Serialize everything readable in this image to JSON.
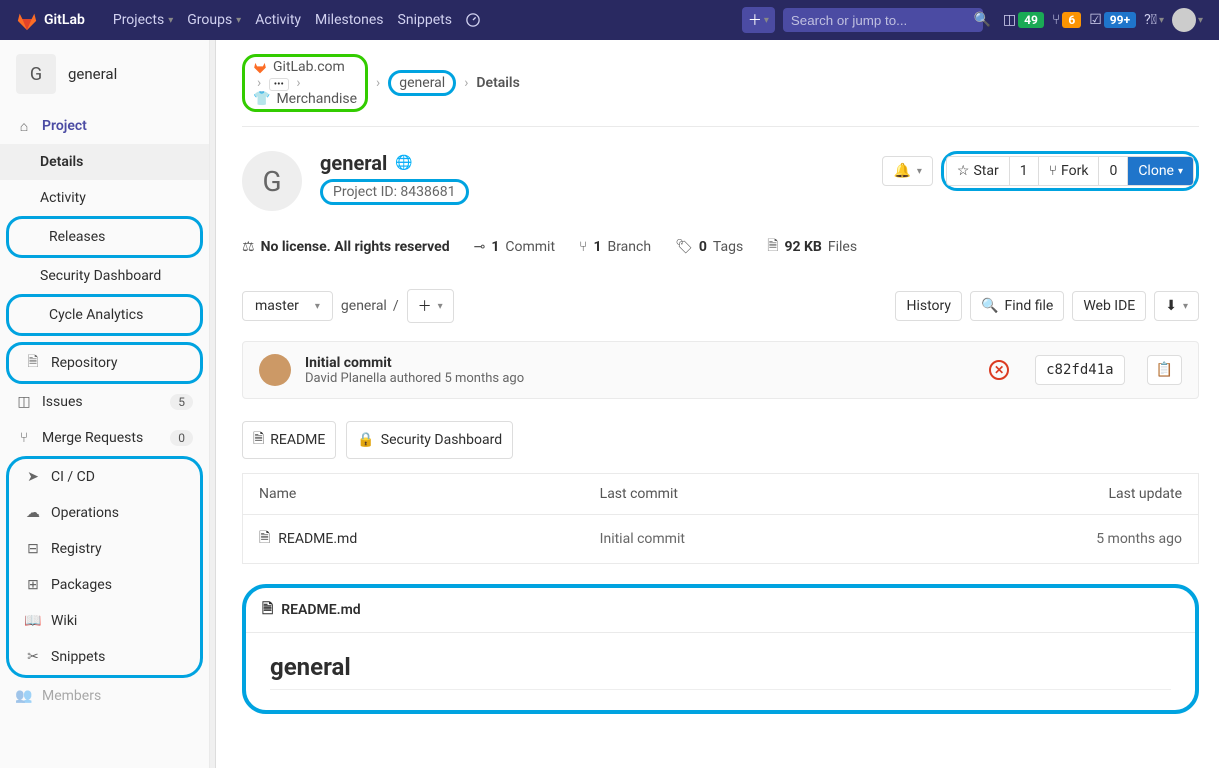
{
  "navbar": {
    "brand": "GitLab",
    "links": [
      "Projects",
      "Groups",
      "Activity",
      "Milestones",
      "Snippets"
    ],
    "search_placeholder": "Search or jump to...",
    "badges": {
      "todos": "49",
      "mrs": "6",
      "issues": "99+"
    }
  },
  "sidebar": {
    "context": {
      "letter": "G",
      "name": "general"
    },
    "project_label": "Project",
    "project_subs": [
      "Details",
      "Activity",
      "Releases",
      "Security Dashboard",
      "Cycle Analytics"
    ],
    "items": [
      {
        "label": "Repository",
        "icon": "doc"
      },
      {
        "label": "Issues",
        "icon": "issues",
        "count": "5"
      },
      {
        "label": "Merge Requests",
        "icon": "mr",
        "count": "0"
      },
      {
        "label": "CI / CD",
        "icon": "rocket"
      },
      {
        "label": "Operations",
        "icon": "cloud"
      },
      {
        "label": "Registry",
        "icon": "disk"
      },
      {
        "label": "Packages",
        "icon": "package"
      },
      {
        "label": "Wiki",
        "icon": "book"
      },
      {
        "label": "Snippets",
        "icon": "scissors"
      },
      {
        "label": "Members",
        "icon": "users"
      }
    ]
  },
  "breadcrumb": {
    "root": "GitLab.com",
    "group": "Merchandise",
    "project": "general",
    "page": "Details"
  },
  "project": {
    "letter": "G",
    "name": "general",
    "id_label": "Project ID: 8438681",
    "star_label": "Star",
    "star_count": "1",
    "fork_label": "Fork",
    "fork_count": "0",
    "clone_label": "Clone"
  },
  "info": {
    "license": "No license. All rights reserved",
    "commits_n": "1",
    "commits_l": "Commit",
    "branches_n": "1",
    "branches_l": "Branch",
    "tags_n": "0",
    "tags_l": "Tags",
    "size_n": "92 KB",
    "size_l": "Files"
  },
  "branch": {
    "ref": "master",
    "path": "general",
    "sep": "/",
    "history": "History",
    "find": "Find file",
    "ide": "Web IDE"
  },
  "commit": {
    "title": "Initial commit",
    "meta": "David Planella authored 5 months ago",
    "sha": "c82fd41a"
  },
  "quicklinks": {
    "readme": "README",
    "security": "Security Dashboard"
  },
  "table": {
    "headers": [
      "Name",
      "Last commit",
      "Last update"
    ],
    "rows": [
      {
        "name": "README.md",
        "last_commit": "Initial commit",
        "last_update": "5 months ago"
      }
    ]
  },
  "readme": {
    "filename": "README.md",
    "heading": "general"
  }
}
